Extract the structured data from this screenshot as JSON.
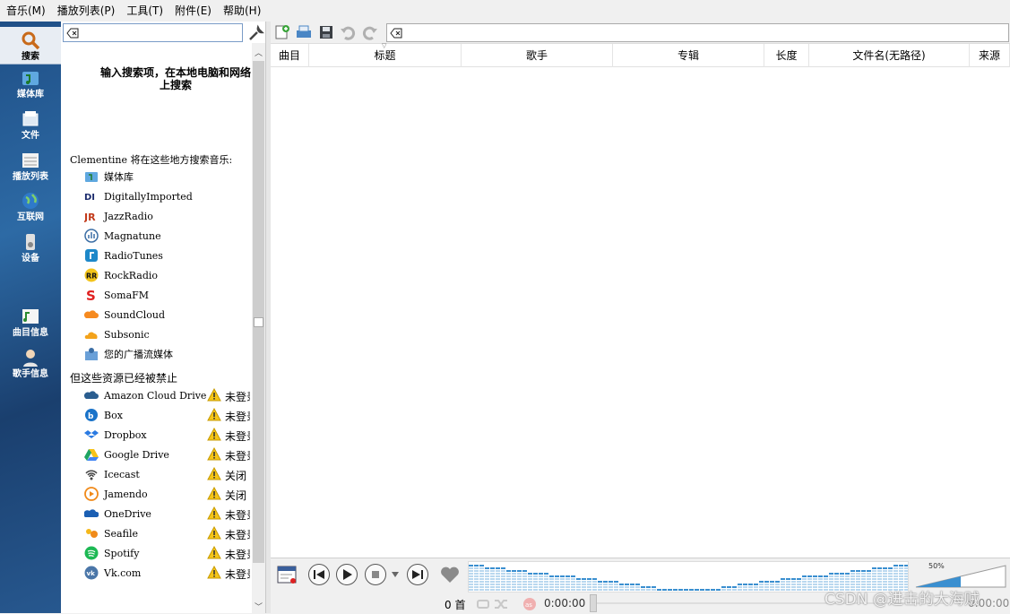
{
  "menu": [
    "音乐(M)",
    "播放列表(P)",
    "工具(T)",
    "附件(E)",
    "帮助(H)"
  ],
  "sidebar": {
    "tabs": [
      {
        "label": "搜索",
        "icon": "search-icon",
        "active": true
      },
      {
        "label": "媒体库",
        "icon": "library-icon"
      },
      {
        "label": "文件",
        "icon": "files-icon"
      },
      {
        "label": "播放列表",
        "icon": "playlist-icon"
      },
      {
        "label": "互联网",
        "icon": "globe-icon"
      },
      {
        "label": "设备",
        "icon": "device-icon"
      },
      {
        "label": "曲目信息",
        "icon": "song-info-icon"
      },
      {
        "label": "歌手信息",
        "icon": "artist-info-icon"
      }
    ]
  },
  "search": {
    "value": "",
    "hint": "输入搜索项，在本地电脑和网络上搜索"
  },
  "sources": {
    "title": "Clementine 将在这些地方搜索音乐:",
    "items": [
      {
        "name": "媒体库",
        "icon": "library-icon"
      },
      {
        "name": "DigitallyImported",
        "icon": "di-icon"
      },
      {
        "name": "JazzRadio",
        "icon": "jr-icon"
      },
      {
        "name": "Magnatune",
        "icon": "magnatune-icon"
      },
      {
        "name": "RadioTunes",
        "icon": "radiotunes-icon"
      },
      {
        "name": "RockRadio",
        "icon": "rr-icon"
      },
      {
        "name": "SomaFM",
        "icon": "somafm-icon"
      },
      {
        "name": "SoundCloud",
        "icon": "soundcloud-icon"
      },
      {
        "name": "Subsonic",
        "icon": "subsonic-icon"
      },
      {
        "name": "您的广播流媒体",
        "icon": "radio-stream-icon"
      }
    ]
  },
  "disabled": {
    "title": "但这些资源已经被禁止",
    "items": [
      {
        "name": "Amazon Cloud Drive",
        "status": "未登录",
        "icon": "amazon-icon"
      },
      {
        "name": "Box",
        "status": "未登录",
        "icon": "box-icon"
      },
      {
        "name": "Dropbox",
        "status": "未登录",
        "icon": "dropbox-icon"
      },
      {
        "name": "Google Drive",
        "status": "未登录",
        "icon": "google-drive-icon"
      },
      {
        "name": "Icecast",
        "status": "关闭",
        "icon": "icecast-icon"
      },
      {
        "name": "Jamendo",
        "status": "关闭",
        "icon": "jamendo-icon"
      },
      {
        "name": "OneDrive",
        "status": "未登录",
        "icon": "onedrive-icon"
      },
      {
        "name": "Seafile",
        "status": "未登录",
        "icon": "seafile-icon"
      },
      {
        "name": "Spotify",
        "status": "未登录",
        "icon": "spotify-icon"
      },
      {
        "name": "Vk.com",
        "status": "未登录",
        "icon": "vk-icon"
      }
    ]
  },
  "playlist": {
    "columns": [
      "曲目",
      "标题",
      "歌手",
      "专辑",
      "长度",
      "文件名(无路径)",
      "来源"
    ],
    "filter": ""
  },
  "player": {
    "volume_label": "50%",
    "volume": 0.5,
    "track_count": "0 首",
    "elapsed": "0:00:00",
    "total": "0:00:00"
  },
  "watermark": "CSDN @进击的大海贼",
  "colors": {
    "sidebar": "#245b95",
    "analyzer": "#3a8fd0",
    "accent": "#7a9cc7"
  }
}
